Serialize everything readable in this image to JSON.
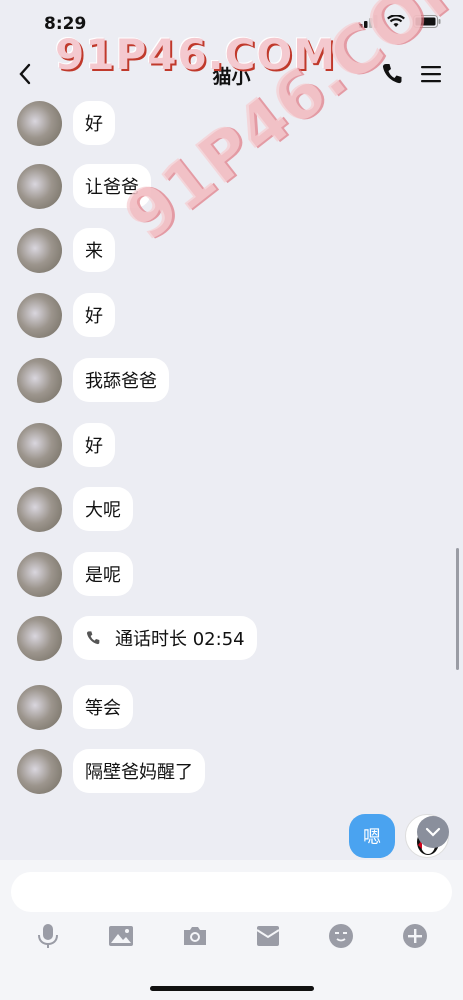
{
  "status": {
    "time": "8:29"
  },
  "header": {
    "title": "猫小"
  },
  "watermark": {
    "text": "91P46.COM"
  },
  "messages": [
    {
      "text": "好"
    },
    {
      "text": "让爸爸"
    },
    {
      "text": "来"
    },
    {
      "text": "好"
    },
    {
      "text": "我舔爸爸"
    },
    {
      "text": "好"
    },
    {
      "text": "大呢"
    },
    {
      "text": "是呢"
    },
    {
      "text": "通话时长 02:54",
      "type": "call"
    },
    {
      "text": "等会"
    },
    {
      "text": "隔壁爸妈醒了"
    }
  ],
  "my_message": {
    "text": "嗯"
  },
  "input": {
    "placeholder": ""
  },
  "toolbar": [
    "microphone-icon",
    "image-icon",
    "camera-icon",
    "red-packet-icon",
    "emoji-icon",
    "plus-icon"
  ],
  "colors": {
    "background": "#ecedf3",
    "my_bubble": "#4aa3f0",
    "bubble": "#ffffff"
  }
}
